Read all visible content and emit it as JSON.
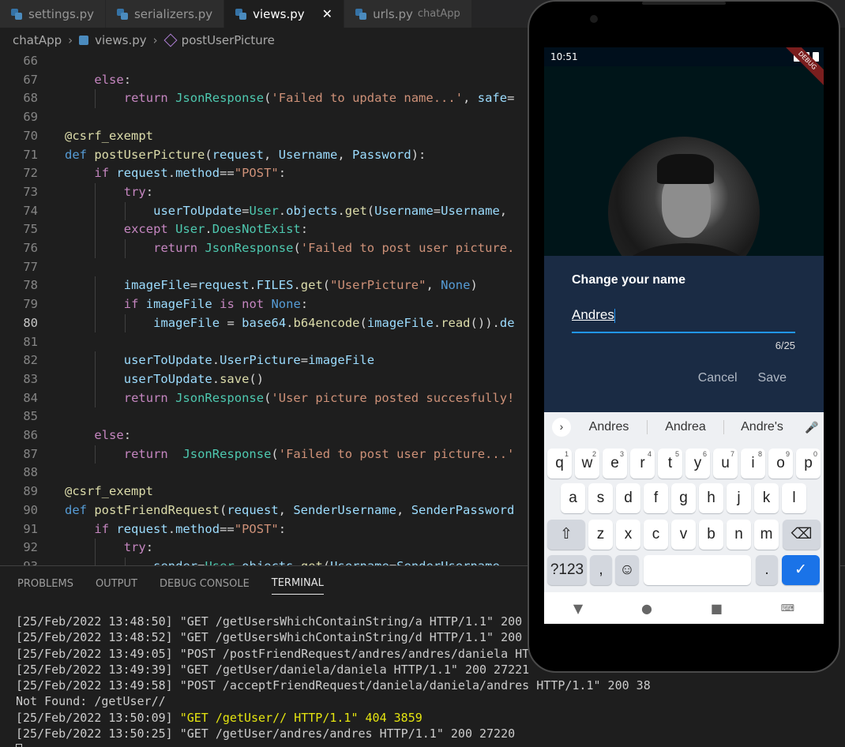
{
  "tabs": [
    {
      "label": "settings.py",
      "sub": "",
      "active": false
    },
    {
      "label": "serializers.py",
      "sub": "",
      "active": false
    },
    {
      "label": "views.py",
      "sub": "",
      "active": true
    },
    {
      "label": "urls.py",
      "sub": "chatApp",
      "active": false
    }
  ],
  "close_glyph": "✕",
  "breadcrumb": {
    "folder": "chatApp",
    "file": "views.py",
    "symbol": "postUserPicture",
    "sep": "›"
  },
  "editor": {
    "current_line": 80,
    "lines": [
      {
        "n": "66",
        "t": ""
      },
      {
        "n": "67",
        "t": "    else:"
      },
      {
        "n": "68",
        "t": "        return JsonResponse('Failed to update name...', safe="
      },
      {
        "n": "69",
        "t": ""
      },
      {
        "n": "70",
        "t": "@csrf_exempt"
      },
      {
        "n": "71",
        "t": "def postUserPicture(request, Username, Password):"
      },
      {
        "n": "72",
        "t": "    if request.method==\"POST\":"
      },
      {
        "n": "73",
        "t": "        try:"
      },
      {
        "n": "74",
        "t": "            userToUpdate=User.objects.get(Username=Username,"
      },
      {
        "n": "75",
        "t": "        except User.DoesNotExist:"
      },
      {
        "n": "76",
        "t": "            return JsonResponse('Failed to post user picture."
      },
      {
        "n": "77",
        "t": ""
      },
      {
        "n": "78",
        "t": "        imageFile=request.FILES.get(\"UserPicture\", None)"
      },
      {
        "n": "79",
        "t": "        if imageFile is not None:"
      },
      {
        "n": "80",
        "t": "            imageFile = base64.b64encode(imageFile.read()).de"
      },
      {
        "n": "81",
        "t": ""
      },
      {
        "n": "82",
        "t": "        userToUpdate.UserPicture=imageFile"
      },
      {
        "n": "83",
        "t": "        userToUpdate.save()"
      },
      {
        "n": "84",
        "t": "        return JsonResponse('User picture posted succesfully!"
      },
      {
        "n": "85",
        "t": ""
      },
      {
        "n": "86",
        "t": "    else:"
      },
      {
        "n": "87",
        "t": "        return  JsonResponse('Failed to post user picture...'"
      },
      {
        "n": "88",
        "t": ""
      },
      {
        "n": "89",
        "t": "@csrf_exempt"
      },
      {
        "n": "90",
        "t": "def postFriendRequest(request, SenderUsername, SenderPassword"
      },
      {
        "n": "91",
        "t": "    if request.method==\"POST\":"
      },
      {
        "n": "92",
        "t": "        try:"
      },
      {
        "n": "93",
        "t": "            sender=User.objects.get(Username=SenderUsername"
      }
    ]
  },
  "panel": {
    "tabs": [
      "PROBLEMS",
      "OUTPUT",
      "DEBUG CONSOLE",
      "TERMINAL"
    ],
    "active_tab": "TERMINAL",
    "terminal_lines": [
      {
        "text": "[25/Feb/2022 13:48:50] \"GET /getUsersWhichContainString/a HTTP/1.1\" 200",
        "hl": false
      },
      {
        "text": "[25/Feb/2022 13:48:52] \"GET /getUsersWhichContainString/d HTTP/1.1\" 200",
        "hl": false
      },
      {
        "text": "[25/Feb/2022 13:49:05] \"POST /postFriendRequest/andres/andres/daniela HTT",
        "hl": false
      },
      {
        "text": "[25/Feb/2022 13:49:39] \"GET /getUser/daniela/daniela HTTP/1.1\" 200 27221",
        "hl": false
      },
      {
        "text": "[25/Feb/2022 13:49:58] \"POST /acceptFriendRequest/daniela/daniela/andres HTTP/1.1\" 200 38",
        "hl": false
      },
      {
        "text": "Not Found: /getUser//",
        "hl": false
      },
      {
        "text_a": "[25/Feb/2022 13:50:09] ",
        "text_b": "\"GET /getUser// HTTP/1.1\" 404 3859",
        "hl": true
      },
      {
        "text": "[25/Feb/2022 13:50:25] \"GET /getUser/andres/andres HTTP/1.1\" 200 27220",
        "hl": false
      }
    ]
  },
  "phone": {
    "time": "10:51",
    "debug_banner": "DEBUG",
    "dialog": {
      "title": "Change your name",
      "value": "Andres",
      "counter": "6/25",
      "cancel": "Cancel",
      "save": "Save"
    },
    "keyboard": {
      "suggestions": [
        "Andres",
        "Andrea",
        "Andre's"
      ],
      "suggest_chevron": "›",
      "mic": "🎤",
      "row1": [
        "q",
        "w",
        "e",
        "r",
        "t",
        "y",
        "u",
        "i",
        "o",
        "p"
      ],
      "row1_sup": [
        "1",
        "2",
        "3",
        "4",
        "5",
        "6",
        "7",
        "8",
        "9",
        "0"
      ],
      "row2": [
        "a",
        "s",
        "d",
        "f",
        "g",
        "h",
        "j",
        "k",
        "l"
      ],
      "row3": [
        "z",
        "x",
        "c",
        "v",
        "b",
        "n",
        "m"
      ],
      "shift": "⇧",
      "backspace": "⌫",
      "symbols": "?123",
      "comma": ",",
      "emoji": "☺",
      "period": ".",
      "enter": "✓"
    },
    "nav": {
      "back": "▼",
      "home": "●",
      "recents": "■",
      "kbd": "⌨"
    },
    "colors": {
      "accent": "#2196f3",
      "dialog_bg": "#1a2b44",
      "enter_key": "#1a73e8"
    }
  },
  "icons": {
    "tab_file": "python-file-icon",
    "symbol": "method-cube-icon"
  }
}
